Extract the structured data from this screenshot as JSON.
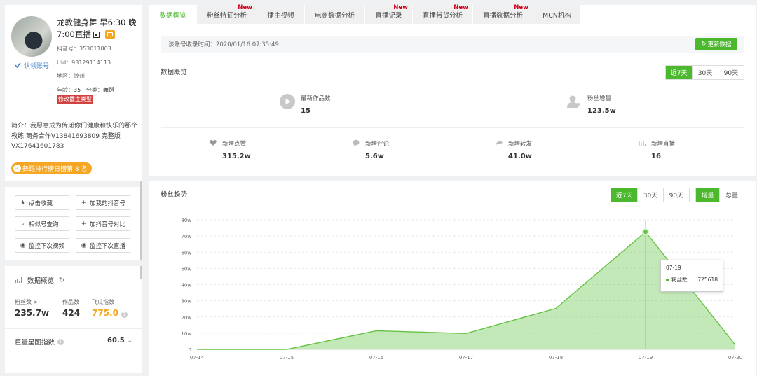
{
  "profile": {
    "name": "龙教健身舞 早6:30 晚7:00直播",
    "verified_label": "认领账号",
    "douyin_id": "抖音号：353011803",
    "uid": "Uid：93129114113",
    "region": "地区：锦州",
    "age_label": "年龄：",
    "age": "35",
    "category_label": "分类：",
    "category": "舞蹈",
    "modify_button": "修改播主类型",
    "intro": "简介：我愿意成为传递你们健康和快乐的那个教练 商务合作V13841693809 完整版VX17641601783",
    "rank_badge": "舞蹈排行榜日榜第 8 名"
  },
  "actions": [
    {
      "icon": "star-icon",
      "label": "点击收藏"
    },
    {
      "icon": "plus-icon",
      "label": "加我的抖音号"
    },
    {
      "icon": "search-icon",
      "label": "相似号查询"
    },
    {
      "icon": "plus-icon",
      "label": "加抖音号对比"
    },
    {
      "icon": "eye-icon",
      "label": "监控下次视频"
    },
    {
      "icon": "eye-icon",
      "label": "监控下次直播"
    }
  ],
  "side_overview": {
    "title": "数据概览",
    "fans_label": "粉丝数 >",
    "fans_value": "235.7w",
    "works_label": "作品数",
    "works_value": "424",
    "fg_label": "飞瓜指数",
    "fg_value": "775.0",
    "jl_label": "巨量星图指数",
    "jl_value": "60.5"
  },
  "tabs": [
    {
      "label": "数据概览",
      "active": true,
      "new": false
    },
    {
      "label": "粉丝特征分析",
      "active": false,
      "new": true
    },
    {
      "label": "播主视频",
      "active": false,
      "new": false
    },
    {
      "label": "电商数据分析",
      "active": false,
      "new": false
    },
    {
      "label": "直播记录",
      "active": false,
      "new": true
    },
    {
      "label": "直播带货分析",
      "active": false,
      "new": true
    },
    {
      "label": "直播数据分析",
      "active": false,
      "new": true
    },
    {
      "label": "MCN机构",
      "active": false,
      "new": false
    }
  ],
  "new_badge": "New",
  "collect_time": "该账号收录时间：2020/01/16 07:35:49",
  "update_button": "更新数据",
  "overview": {
    "title": "数据概览",
    "ranges": [
      "近7天",
      "30天",
      "90天"
    ],
    "latest_works_label": "最新作品数",
    "latest_works_value": "15",
    "fans_inc_label": "粉丝增量",
    "fans_inc_value": "123.5w",
    "likes_label": "新增点赞",
    "likes_value": "315.2w",
    "comments_label": "新增评论",
    "comments_value": "5.6w",
    "shares_label": "新增转发",
    "shares_value": "41.0w",
    "live_label": "新增直播",
    "live_value": "16"
  },
  "trend": {
    "title": "粉丝趋势",
    "ranges": [
      "近7天",
      "30天",
      "90天"
    ],
    "modes": [
      "增量",
      "总量"
    ],
    "tooltip_date": "07-19",
    "tooltip_label": "粉丝数",
    "tooltip_value": "725618"
  },
  "colors": {
    "accent": "#4cb82e",
    "orange": "#f5a623",
    "red": "#d0423f",
    "new": "#d0021b"
  },
  "chart_data": {
    "type": "area",
    "x": [
      "07-14",
      "07-15",
      "07-16",
      "07-17",
      "07-18",
      "07-19",
      "07-20"
    ],
    "yticks": [
      "0",
      "10w",
      "20w",
      "30w",
      "40w",
      "50w",
      "60w",
      "70w",
      "80w"
    ],
    "ylim": [
      0,
      800000
    ],
    "series": [
      {
        "name": "粉丝数",
        "values": [
          0,
          0,
          115000,
          98000,
          253000,
          725618,
          28000
        ]
      }
    ],
    "grid": true,
    "highlight_index": 5
  }
}
